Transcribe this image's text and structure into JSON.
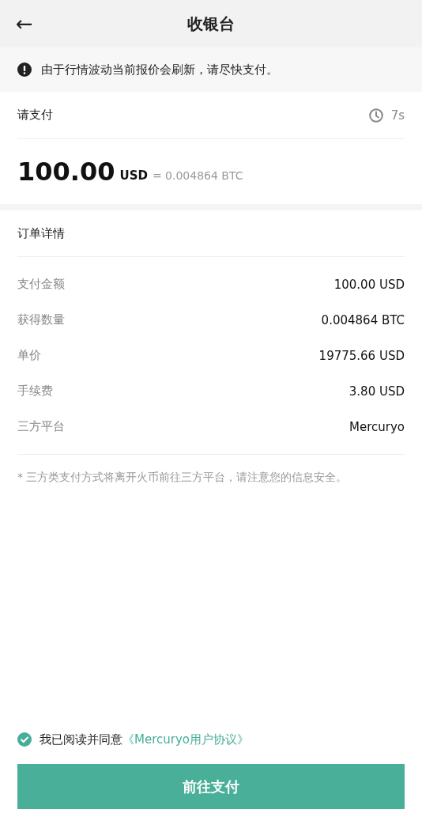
{
  "header": {
    "back": "←",
    "title": "收银台"
  },
  "notice": {
    "text": "由于行情波动当前报价会刷新，请尽快支付。"
  },
  "payment": {
    "label": "请支付",
    "countdown": "7s",
    "amount": "100.00",
    "currency": "USD",
    "conversion": "= 0.004864 BTC"
  },
  "order": {
    "title": "订单详情",
    "rows": [
      {
        "label": "支付金额",
        "value": "100.00 USD"
      },
      {
        "label": "获得数量",
        "value": "0.004864 BTC"
      },
      {
        "label": "单价",
        "value": "19775.66 USD"
      },
      {
        "label": "手续费",
        "value": "3.80 USD"
      },
      {
        "label": "三方平台",
        "value": "Mercuryo"
      }
    ],
    "note": "* 三方类支付方式将离开火币前往三方平台，请注意您的信息安全。"
  },
  "agreement": {
    "checked": true,
    "text": "我已阅读并同意",
    "link": "《Mercuryo用户协议》"
  },
  "submit": {
    "label": "前往支付"
  }
}
